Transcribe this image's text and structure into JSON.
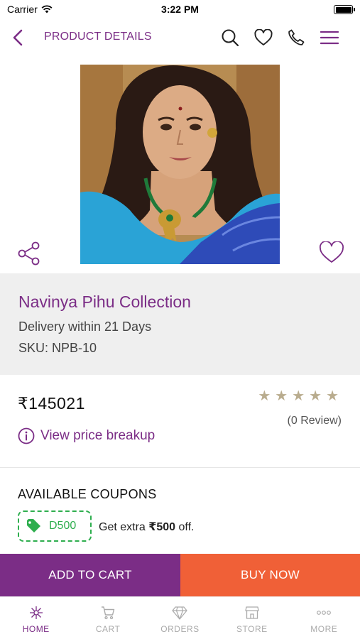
{
  "status_bar": {
    "carrier": "Carrier",
    "time": "3:22 PM"
  },
  "header": {
    "title": "PRODUCT DETAILS"
  },
  "product": {
    "name": "Navinya Pihu Collection",
    "delivery": "Delivery within 21 Days",
    "sku": "SKU: NPB-10",
    "price": "₹145021",
    "rating": 0,
    "rating_max": 5,
    "reviews": "(0 Review)",
    "price_breakup_label": "View price breakup"
  },
  "coupons": {
    "heading": "AVAILABLE COUPONS",
    "code": "D500",
    "offer_prefix": "Get extra ",
    "offer_amount": "₹500",
    "offer_suffix": " off."
  },
  "actions": {
    "add_to_cart": "ADD TO CART",
    "buy_now": "BUY NOW"
  },
  "tabs": [
    {
      "label": "HOME",
      "icon": "home-icon",
      "active": true
    },
    {
      "label": "CART",
      "icon": "cart-icon",
      "active": false
    },
    {
      "label": "ORDERS",
      "icon": "diamond-icon",
      "active": false
    },
    {
      "label": "STORE",
      "icon": "store-icon",
      "active": false
    },
    {
      "label": "MORE",
      "icon": "more-icon",
      "active": false
    }
  ],
  "colors": {
    "brand": "#7b2d86",
    "buy_now": "#f06037",
    "coupon_green": "#2eae4e",
    "info_bg": "#efefef",
    "star": "#b9ac8e"
  }
}
